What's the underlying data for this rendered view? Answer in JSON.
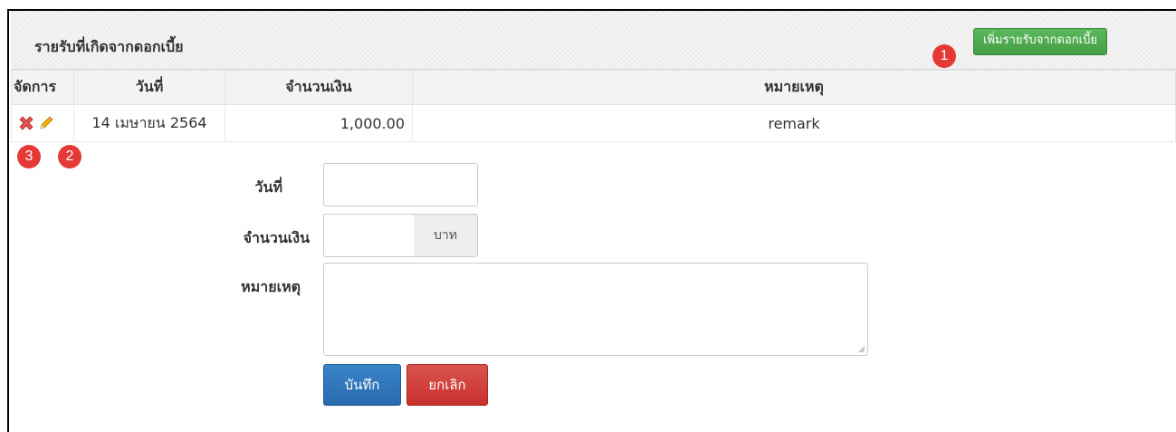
{
  "panel": {
    "title": "รายรับที่เกิดจากดอกเบี้ย",
    "add_button": "เพิ่มรายรับจากดอกเบี้ย"
  },
  "table": {
    "headers": [
      "จัดการ",
      "วันที่",
      "จำนวนเงิน",
      "หมายเหตุ"
    ],
    "rows": [
      {
        "date": "14 เมษายน 2564",
        "amount": "1,000.00",
        "remark": "remark"
      }
    ]
  },
  "form": {
    "date_label": "วันที่",
    "date_value": "",
    "amount_label": "จำนวนเงิน",
    "amount_value": "",
    "amount_unit": "บาท",
    "remark_label": "หมายเหตุ",
    "remark_value": "",
    "save_button": "บันทึก",
    "cancel_button": "ยกเลิก"
  },
  "annotations": {
    "badge_1": "1",
    "badge_2": "2",
    "badge_3": "3",
    "badge_color": "#e53935"
  },
  "colors": {
    "add_button": "#5cb85c",
    "save_button": "#337ab7",
    "cancel_button": "#d9534f",
    "delete_icon": "#d9534f",
    "edit_icon": "#e6a400"
  }
}
